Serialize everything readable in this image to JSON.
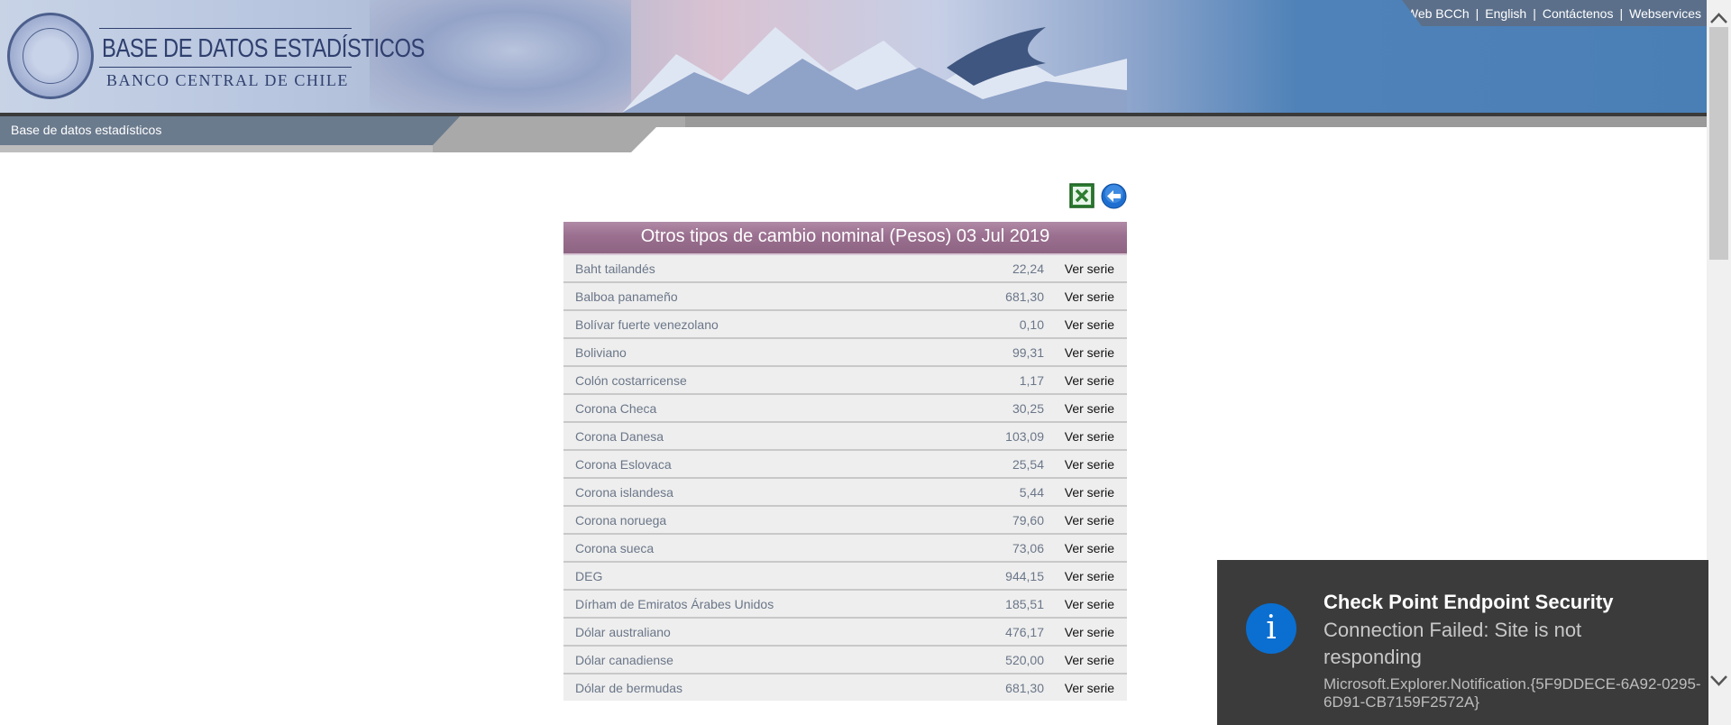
{
  "banner": {
    "title": "BASE DE DATOS ESTADÍSTICOS",
    "subtitle": "BANCO CENTRAL DE CHILE",
    "links": [
      "Web BCCh",
      "English",
      "Contáctenos",
      "Webservices"
    ]
  },
  "nav": {
    "breadcrumb": "Base de datos estadísticos"
  },
  "toolbar": {
    "excel_icon": "excel-export-icon",
    "back_icon": "back-arrow-icon"
  },
  "table": {
    "title": "Otros tipos de cambio nominal (Pesos) 03 Jul 2019",
    "link_label": "Ver serie",
    "rows": [
      {
        "name": "Baht tailandés",
        "value": "22,24"
      },
      {
        "name": "Balboa panameño",
        "value": "681,30"
      },
      {
        "name": "Bolívar fuerte venezolano",
        "value": "0,10"
      },
      {
        "name": "Boliviano",
        "value": "99,31"
      },
      {
        "name": "Colón costarricense",
        "value": "1,17"
      },
      {
        "name": "Corona Checa",
        "value": "30,25"
      },
      {
        "name": "Corona Danesa",
        "value": "103,09"
      },
      {
        "name": "Corona Eslovaca",
        "value": "25,54"
      },
      {
        "name": "Corona islandesa",
        "value": "5,44"
      },
      {
        "name": "Corona noruega",
        "value": "79,60"
      },
      {
        "name": "Corona sueca",
        "value": "73,06"
      },
      {
        "name": "DEG",
        "value": "944,15"
      },
      {
        "name": "Dírham de Emiratos Árabes Unidos",
        "value": "185,51"
      },
      {
        "name": "Dólar australiano",
        "value": "476,17"
      },
      {
        "name": "Dólar canadiense",
        "value": "520,00"
      },
      {
        "name": "Dólar de bermudas",
        "value": "681,30"
      }
    ]
  },
  "notification": {
    "title": "Check Point Endpoint Security",
    "message": "Connection Failed: Site is not responding",
    "source": "Microsoft.Explorer.Notification.{5F9DDECE-6A92-0295-6D91-CB7159F2572A}",
    "icon": "info-icon"
  },
  "colors": {
    "table_header": "#9a6f8f",
    "row_bg": "#eeeeee",
    "toast_bg": "#3b3b3b",
    "info_blue": "#0a6fd1"
  }
}
